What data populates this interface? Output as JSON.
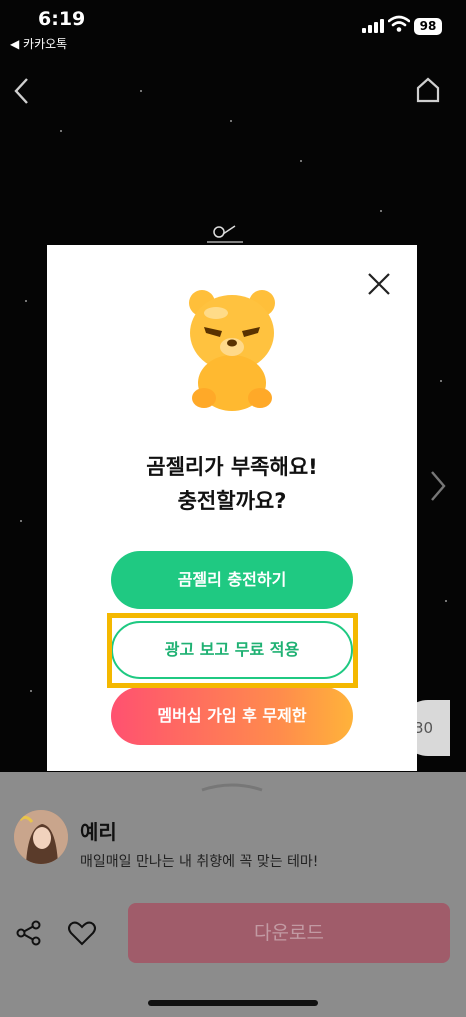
{
  "status_bar": {
    "time": "6:19",
    "back_app": "◀ 카카오톡",
    "battery": "98"
  },
  "preview": {
    "side_badge": "30"
  },
  "modal": {
    "title_line1": "곰젤리가 부족해요!",
    "title_line2": "충전할까요?",
    "charge_button": "곰젤리 충전하기",
    "ad_button": "광고 보고 무료 적용",
    "membership_button": "멤버십 가입 후 무제한",
    "colors": {
      "green": "#1fc982",
      "gradient_start": "#ff5170",
      "gradient_end": "#ffb33a",
      "highlight": "#f4b800"
    }
  },
  "sheet": {
    "creator_name": "예리",
    "description": "매일매일 만나는 내 취향에 꼭 맞는 테마!",
    "download_label": "다운로드"
  },
  "icons": [
    "back-icon",
    "home-icon",
    "next-icon",
    "close-icon",
    "share-icon",
    "heart-icon",
    "bear-mascot-icon"
  ]
}
